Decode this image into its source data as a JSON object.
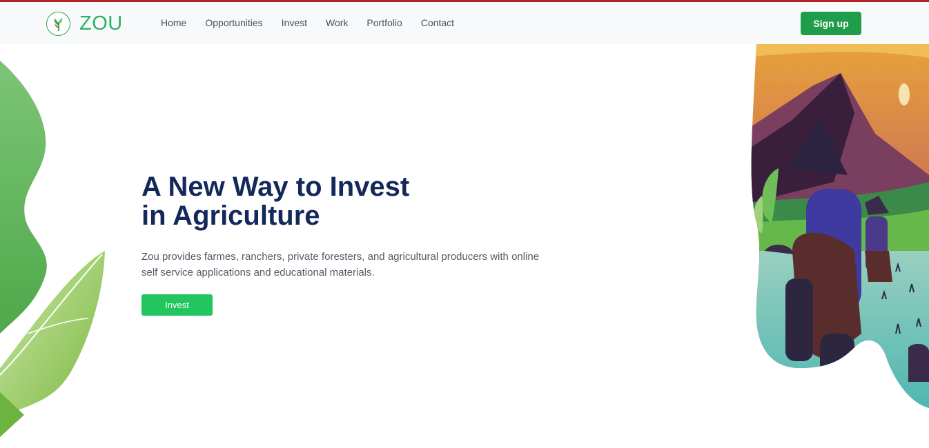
{
  "brand": {
    "name": "ZOU",
    "color": "#28b463"
  },
  "nav": {
    "links": [
      "Home",
      "Opportunities",
      "Invest",
      "Work",
      "Portfolio",
      "Contact"
    ],
    "signup_label": "Sign up"
  },
  "hero": {
    "title": "A New Way to Invest\nin Agriculture",
    "description": "Zou provides farmes, ranchers, private foresters, and agricultural producers with online self service applications and educational materials.",
    "cta_label": "Invest"
  },
  "colors": {
    "accent": "#22c55e",
    "title": "#14295a",
    "topline": "#b22222"
  },
  "icons": [
    "plant-logo-icon",
    "leaf-decoration",
    "farmers-illustration"
  ]
}
